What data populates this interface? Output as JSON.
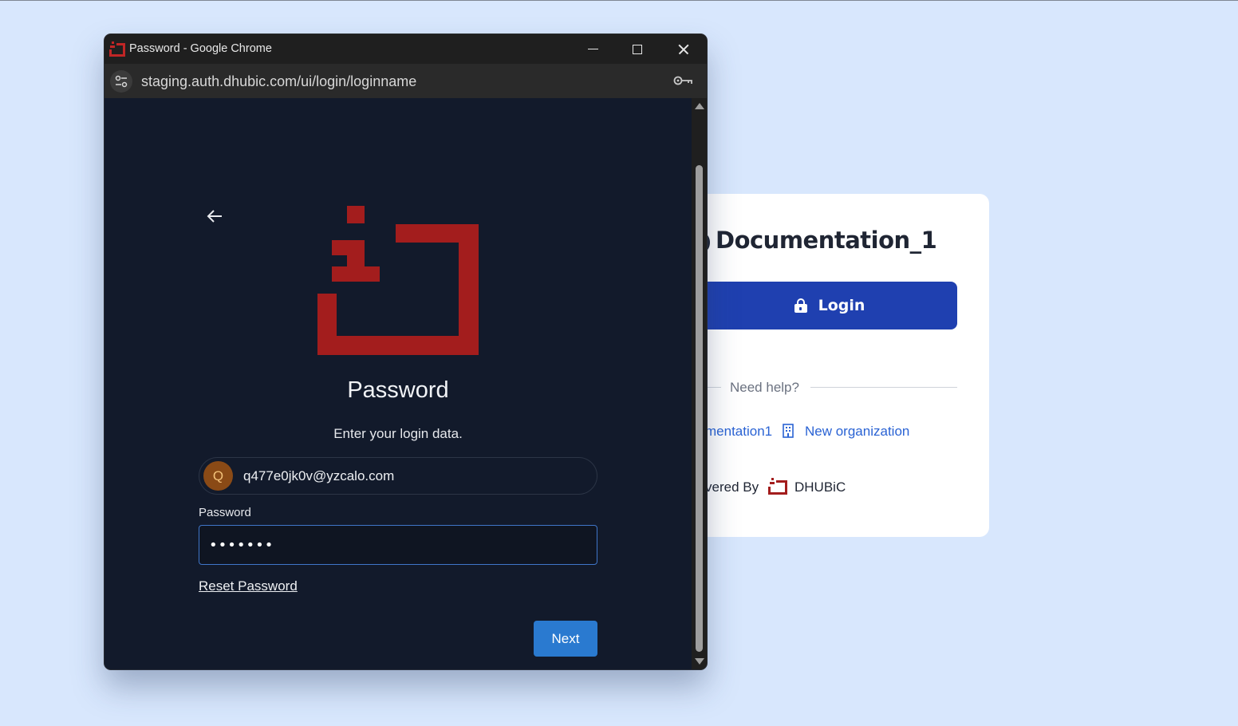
{
  "background_page": {
    "title": "Documentation_1",
    "login_button_label": "Login",
    "help_text": "Need help?",
    "link_1": "mentation1",
    "link_2": "New organization",
    "powered_by": "vered By",
    "brand": "DHUBiC"
  },
  "popup": {
    "window_title": "Password - Google Chrome",
    "url": "staging.auth.dhubic.com/ui/login/loginname",
    "heading": "Password",
    "subtitle": "Enter your login data.",
    "user": {
      "avatar_letter": "Q",
      "email": "q477e0jk0v@yzcalo.com"
    },
    "password_label": "Password",
    "password_value": "•••••••",
    "reset_password_label": "Reset Password",
    "next_button_label": "Next"
  },
  "colors": {
    "brand_red": "#a31d1d",
    "primary_blue": "#1f40b0",
    "next_blue": "#2a7ad0",
    "popup_bg": "#121a2b",
    "page_bg": "#d8e7fd"
  }
}
